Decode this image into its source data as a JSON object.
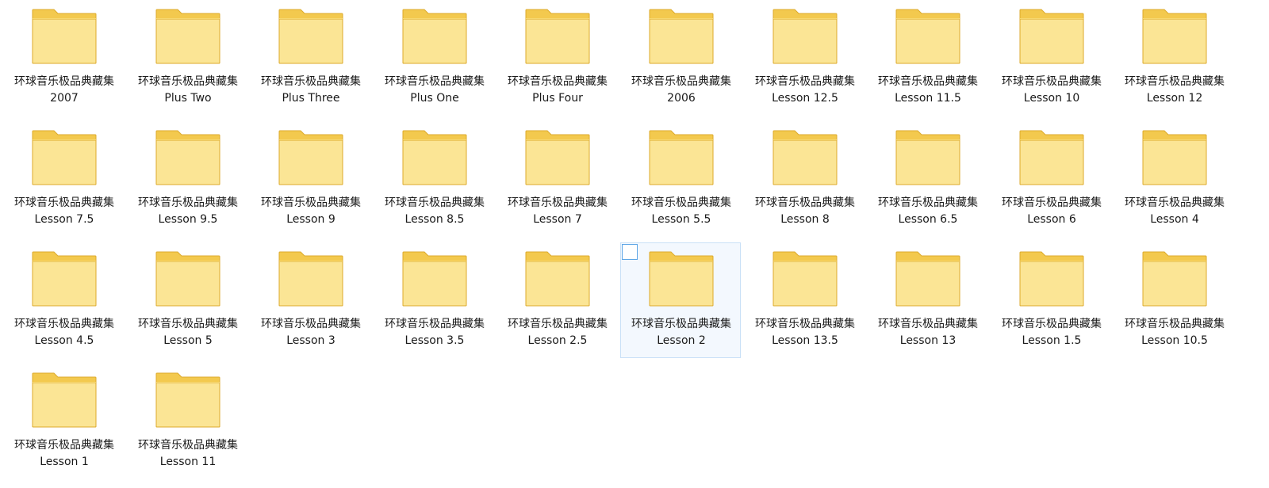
{
  "folders": [
    {
      "line1": "环球音乐极品典藏集",
      "line2": "2007"
    },
    {
      "line1": "环球音乐极品典藏集",
      "line2": "Plus Two"
    },
    {
      "line1": "环球音乐极品典藏集",
      "line2": "Plus Three"
    },
    {
      "line1": "环球音乐极品典藏集",
      "line2": "Plus One"
    },
    {
      "line1": "环球音乐极品典藏集",
      "line2": "Plus Four"
    },
    {
      "line1": "环球音乐极品典藏集",
      "line2": "2006"
    },
    {
      "line1": "环球音乐极品典藏集",
      "line2": "Lesson 12.5"
    },
    {
      "line1": "环球音乐极品典藏集",
      "line2": "Lesson 11.5"
    },
    {
      "line1": "环球音乐极品典藏集",
      "line2": "Lesson 10"
    },
    {
      "line1": "环球音乐极品典藏集",
      "line2": "Lesson 12"
    },
    {
      "line1": "环球音乐极品典藏集",
      "line2": "Lesson 7.5"
    },
    {
      "line1": "环球音乐极品典藏集",
      "line2": "Lesson 9.5"
    },
    {
      "line1": "环球音乐极品典藏集",
      "line2": "Lesson 9"
    },
    {
      "line1": "环球音乐极品典藏集",
      "line2": "Lesson 8.5"
    },
    {
      "line1": "环球音乐极品典藏集",
      "line2": "Lesson 7"
    },
    {
      "line1": "环球音乐极品典藏集",
      "line2": "Lesson 5.5"
    },
    {
      "line1": "环球音乐极品典藏集",
      "line2": "Lesson 8"
    },
    {
      "line1": "环球音乐极品典藏集",
      "line2": "Lesson 6.5"
    },
    {
      "line1": "环球音乐极品典藏集",
      "line2": "Lesson 6"
    },
    {
      "line1": "环球音乐极品典藏集",
      "line2": "Lesson 4"
    },
    {
      "line1": "环球音乐极品典藏集",
      "line2": "Lesson 4.5"
    },
    {
      "line1": "环球音乐极品典藏集",
      "line2": "Lesson 5"
    },
    {
      "line1": "环球音乐极品典藏集",
      "line2": "Lesson 3"
    },
    {
      "line1": "环球音乐极品典藏集",
      "line2": "Lesson 3.5"
    },
    {
      "line1": "环球音乐极品典藏集",
      "line2": "Lesson 2.5"
    },
    {
      "line1": "环球音乐极品典藏集",
      "line2": "Lesson 2",
      "hovered": true
    },
    {
      "line1": "环球音乐极品典藏集",
      "line2": "Lesson 13.5"
    },
    {
      "line1": "环球音乐极品典藏集",
      "line2": "Lesson 13"
    },
    {
      "line1": "环球音乐极品典藏集",
      "line2": "Lesson 1.5"
    },
    {
      "line1": "环球音乐极品典藏集",
      "line2": "Lesson 10.5"
    },
    {
      "line1": "环球音乐极品典藏集",
      "line2": "Lesson 1"
    },
    {
      "line1": "环球音乐极品典藏集",
      "line2": "Lesson 11"
    }
  ],
  "icon": "folder-icon",
  "colors": {
    "folder_body": "#fbe595",
    "folder_back": "#f3c94e",
    "folder_outline": "#dcaa2c",
    "selection_bg": "#f3f8fe",
    "selection_border": "#c9e0f7",
    "checkbox_border": "#5ea6e6"
  }
}
